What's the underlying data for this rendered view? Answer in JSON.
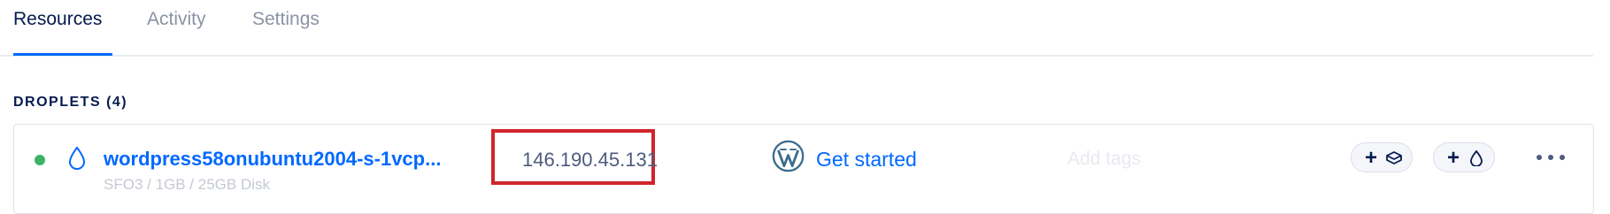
{
  "tabs": [
    {
      "label": "Resources"
    },
    {
      "label": "Activity"
    },
    {
      "label": "Settings"
    }
  ],
  "section": {
    "label": "DROPLETS (4)"
  },
  "droplet": {
    "name": "wordpress58onubuntu2004-s-1vcp...",
    "meta": "SFO3 / 1GB / 25GB Disk",
    "ip": "146.190.45.131",
    "app_link": "Get started",
    "tags_placeholder": "Add tags",
    "status_color": "#3bb564"
  },
  "actions": {
    "add_volume_icon": "plus-volume-icon",
    "add_droplet_icon": "plus-droplet-icon",
    "more_icon": "more-options-icon"
  },
  "colors": {
    "accent": "#0069ff",
    "highlight_box": "#d0252c"
  }
}
